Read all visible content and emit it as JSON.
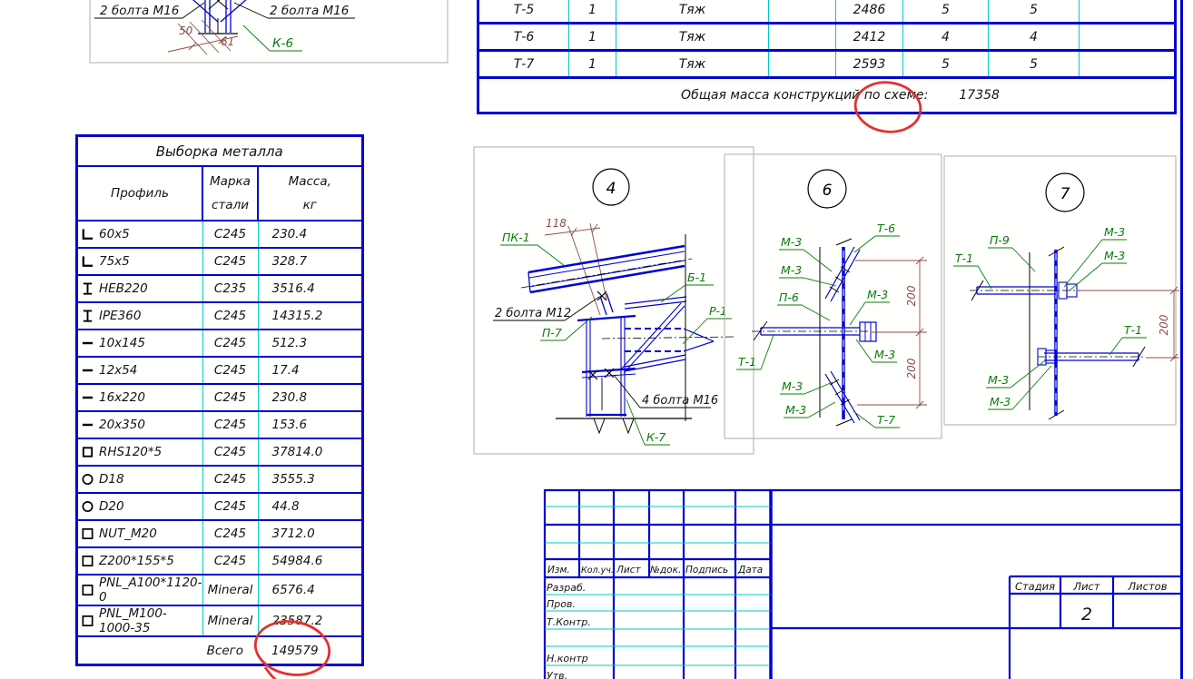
{
  "colors": {
    "line_blue": "#0003CE",
    "divider_cyan": "#00C9C9",
    "label_green": "#0A7C0A",
    "dim_red": "#8C4A4A",
    "annotation_red": "#E23030",
    "viewport_gray": "#ACACAC"
  },
  "top_left_detail": {
    "bolts_left": "2 болта М16",
    "bolts_right": "2 болта М16",
    "dim_a": "50",
    "dim_b": "61",
    "mark": "К-6"
  },
  "top_table": {
    "rows": [
      {
        "mark": "Т-5",
        "qty": "1",
        "type": "Тяж",
        "mass": "2486",
        "n1": "5",
        "n2": "5"
      },
      {
        "mark": "Т-6",
        "qty": "1",
        "type": "Тяж",
        "mass": "2412",
        "n1": "4",
        "n2": "4"
      },
      {
        "mark": "Т-7",
        "qty": "1",
        "type": "Тяж",
        "mass": "2593",
        "n1": "5",
        "n2": "5"
      }
    ],
    "footer_label": "Общая масса конструкций по схеме:",
    "footer_value": "17358"
  },
  "metal_table": {
    "title": "Выборка металла",
    "col_profile": "Профиль",
    "col_steel_1": "Марка",
    "col_steel_2": "стали",
    "col_mass_1": "Масса,",
    "col_mass_2": "кг",
    "rows": [
      {
        "icon": "angle",
        "profile": "60x5",
        "steel": "С245",
        "mass": "230.4"
      },
      {
        "icon": "angle",
        "profile": "75x5",
        "steel": "С245",
        "mass": "328.7"
      },
      {
        "icon": "ibeam",
        "profile": "HEB220",
        "steel": "С235",
        "mass": "3516.4"
      },
      {
        "icon": "ibeam",
        "profile": "IPE360",
        "steel": "С245",
        "mass": "14315.2"
      },
      {
        "icon": "flat",
        "profile": "10x145",
        "steel": "С245",
        "mass": "512.3"
      },
      {
        "icon": "flat",
        "profile": "12x54",
        "steel": "С245",
        "mass": "17.4"
      },
      {
        "icon": "flat",
        "profile": "16x220",
        "steel": "С245",
        "mass": "230.8"
      },
      {
        "icon": "flat",
        "profile": "20x350",
        "steel": "С245",
        "mass": "153.6"
      },
      {
        "icon": "rhs",
        "profile": "RHS120*5",
        "steel": "С245",
        "mass": "37814.0"
      },
      {
        "icon": "round",
        "profile": "D18",
        "steel": "С245",
        "mass": "3555.3"
      },
      {
        "icon": "round",
        "profile": "D20",
        "steel": "С245",
        "mass": "44.8"
      },
      {
        "icon": "square",
        "profile": "NUT_M20",
        "steel": "С245",
        "mass": "3712.0"
      },
      {
        "icon": "square",
        "profile": "Z200*155*5",
        "steel": "С245",
        "mass": "54984.6"
      },
      {
        "icon": "square",
        "profile": "PNL_A100*1120-0",
        "steel": "Mineral",
        "mass": "6576.4"
      },
      {
        "icon": "square",
        "profile": "PNL_M100-1000-35",
        "steel": "Mineral",
        "mass": "23587.2"
      }
    ],
    "footer_label": "Всего",
    "footer_value": "149579"
  },
  "details": {
    "d4": {
      "number": "4",
      "dim": "118",
      "pk1": "ПК-1",
      "b1": "Б-1",
      "bolts12": "2 болта М12",
      "p7": "П-7",
      "r1": "Р-1",
      "bolts16": "4 болта М16",
      "k7": "К-7"
    },
    "d6": {
      "number": "6",
      "dim": "200",
      "t6": "Т-6",
      "m3": "М-3",
      "p6": "П-6",
      "t1": "Т-1",
      "t7": "Т-7"
    },
    "d7": {
      "number": "7",
      "dim": "200",
      "p9": "П-9",
      "t1": "Т-1",
      "m3": "М-3"
    }
  },
  "stamp": {
    "izm": "Изм.",
    "koluch": "Кол.уч.",
    "list": "Лист",
    "ndok": "№док.",
    "podpis": "Подпись",
    "data": "Дата",
    "razrab": "Разраб.",
    "prov": "Пров.",
    "tkontr": "Т.Контр.",
    "nkontr": "Н.контр",
    "utv": "Утв.",
    "stadiya": "Стадия",
    "list_col": "Лист",
    "listov": "Листов",
    "sheet_number": "2"
  }
}
